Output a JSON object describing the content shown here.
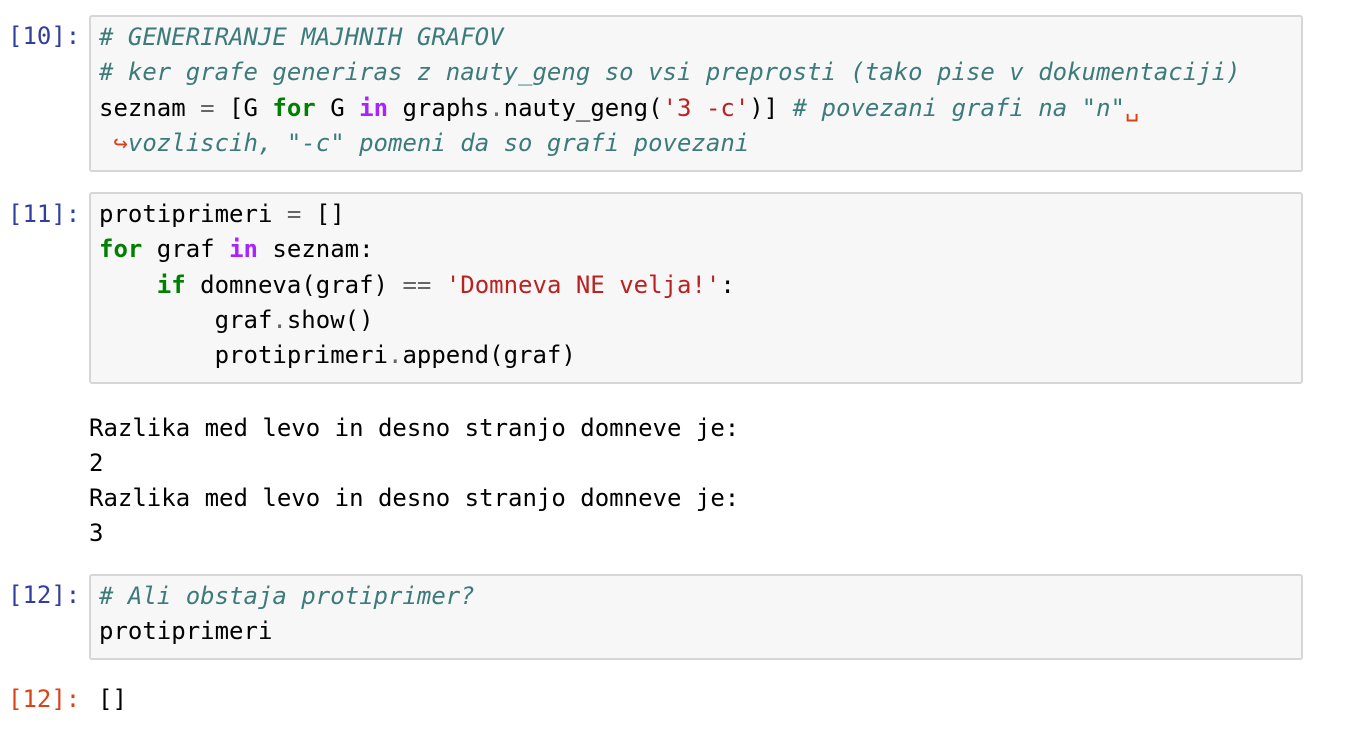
{
  "cells": [
    {
      "prompt": "[10]:",
      "lines": [
        [
          {
            "t": "cm",
            "v": "# GENERIRANJE MAJHNIH GRAFOV"
          }
        ],
        [
          {
            "t": "cm",
            "v": "# ker grafe generiras z nauty_geng so vsi preprosti (tako pise v dokumentaciji)"
          }
        ],
        [
          {
            "t": "n",
            "v": "seznam "
          },
          {
            "t": "op",
            "v": "="
          },
          {
            "t": "n",
            "v": " [G "
          },
          {
            "t": "kw",
            "v": "for"
          },
          {
            "t": "n",
            "v": " G "
          },
          {
            "t": "ow",
            "v": "in"
          },
          {
            "t": "n",
            "v": " graphs"
          },
          {
            "t": "op",
            "v": "."
          },
          {
            "t": "n",
            "v": "nauty_geng("
          },
          {
            "t": "st",
            "v": "'3 -c'"
          },
          {
            "t": "n",
            "v": ")] "
          },
          {
            "t": "cm",
            "v": "# povezani grafi na \"n\""
          },
          {
            "t": "cont",
            "v": "␣"
          }
        ],
        [
          {
            "t": "cont",
            "v": " ↪"
          },
          {
            "t": "cm",
            "v": "vozliscih, \"-c\" pomeni da so grafi povezani"
          }
        ]
      ]
    },
    {
      "prompt": "[11]:",
      "lines": [
        [
          {
            "t": "n",
            "v": "protiprimeri "
          },
          {
            "t": "op",
            "v": "="
          },
          {
            "t": "n",
            "v": " []"
          }
        ],
        [
          {
            "t": "kw",
            "v": "for"
          },
          {
            "t": "n",
            "v": " graf "
          },
          {
            "t": "ow",
            "v": "in"
          },
          {
            "t": "n",
            "v": " seznam:"
          }
        ],
        [
          {
            "t": "n",
            "v": "    "
          },
          {
            "t": "kw",
            "v": "if"
          },
          {
            "t": "n",
            "v": " domneva(graf) "
          },
          {
            "t": "op",
            "v": "=="
          },
          {
            "t": "n",
            "v": " "
          },
          {
            "t": "st",
            "v": "'Domneva NE velja!'"
          },
          {
            "t": "n",
            "v": ":"
          }
        ],
        [
          {
            "t": "n",
            "v": "        graf"
          },
          {
            "t": "op",
            "v": "."
          },
          {
            "t": "n",
            "v": "show()"
          }
        ],
        [
          {
            "t": "n",
            "v": "        protiprimeri"
          },
          {
            "t": "op",
            "v": "."
          },
          {
            "t": "n",
            "v": "append(graf)"
          }
        ]
      ],
      "output": [
        "Razlika med levo in desno stranjo domneve je:",
        "2",
        "Razlika med levo in desno stranjo domneve je:",
        "3"
      ]
    },
    {
      "prompt": "[12]:",
      "lines": [
        [
          {
            "t": "cm",
            "v": "# Ali obstaja protiprimer?"
          }
        ],
        [
          {
            "t": "n",
            "v": "protiprimeri"
          }
        ]
      ],
      "out_prompt": "[12]:",
      "out_value": "[]"
    }
  ]
}
